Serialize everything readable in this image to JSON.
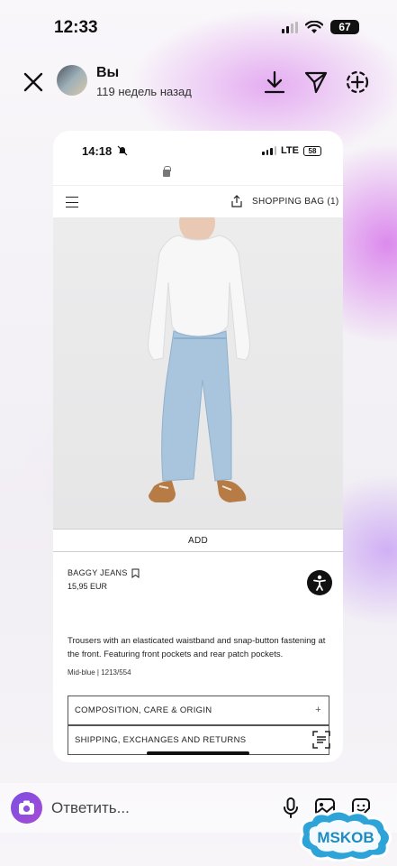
{
  "status_bar": {
    "time": "12:33",
    "battery": "67"
  },
  "story": {
    "owner_name": "Вы",
    "time_ago": "119 недель назад",
    "icons": [
      "close-icon",
      "download-icon",
      "send-icon",
      "add-circle-icon"
    ]
  },
  "inner_screenshot": {
    "status_bar": {
      "time": "14:18",
      "network": "LTE",
      "battery": "58"
    },
    "header": {
      "bag_label": "SHOPPING BAG (1)"
    },
    "add_button": "ADD",
    "product": {
      "name": "BAGGY JEANS",
      "price": "15,95 EUR",
      "description": "Trousers with an elasticated waistband and snap-button fastening at the front. Featuring front pockets and rear patch pockets.",
      "color_ref": "Mid-blue | 1213/554"
    },
    "accordions": [
      {
        "label": "COMPOSITION, CARE & ORIGIN",
        "icon": "+"
      },
      {
        "label": "SHIPPING, EXCHANGES AND RETURNS"
      }
    ]
  },
  "reply": {
    "placeholder": "Ответить..."
  },
  "watermark": "MSKOB",
  "colors": {
    "accent": "#8e4fdc",
    "background_glow": "#e0a0f0"
  }
}
